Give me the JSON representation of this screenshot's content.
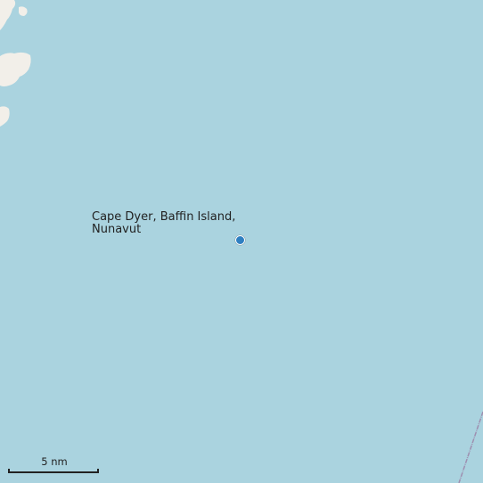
{
  "map": {
    "place_label_line1": "Cape Dyer, Baffin Island,",
    "place_label_line2": "Nunavut",
    "scale_label": "5 nm",
    "marker_icon": "location-dot-icon",
    "colors": {
      "water": "#aad3df",
      "land": "#f2efe9",
      "marker": "#2f7fc1",
      "boundary": "#9e8fb0"
    }
  }
}
